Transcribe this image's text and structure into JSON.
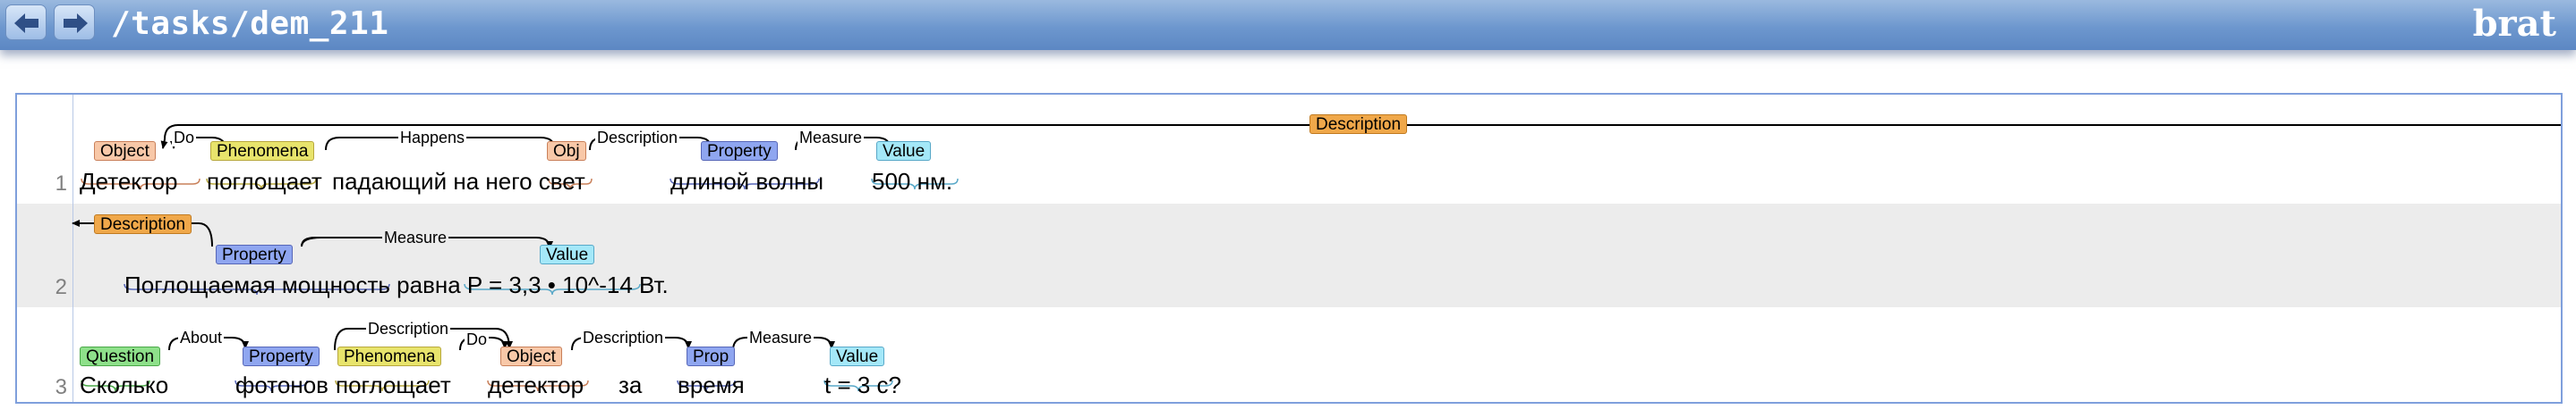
{
  "header": {
    "path": "/tasks/dem_211",
    "logo": "brat",
    "back_icon": "arrow-left-icon",
    "forward_icon": "arrow-right-icon"
  },
  "colors": {
    "Object": "#f8c8a8",
    "Phenomena": "#e8e46c",
    "Property": "#8fa6f0",
    "Value": "#a4e8f8",
    "Question": "#8ee08a",
    "Description": "#f0a84a"
  },
  "sentences": [
    {
      "num": "1",
      "tokens": [
        "Детектор",
        "поглощает",
        "падающий на него свет",
        "длиной волны",
        "500 нм."
      ],
      "labels": [
        "Object",
        "Phenomena",
        "Obj",
        "Property",
        "Value",
        "Description"
      ],
      "arcs": [
        "Do",
        "Happens",
        "Description",
        "Measure"
      ]
    },
    {
      "num": "2",
      "tokens": [
        "Поглощаемая мощность равна P = 3,3 • 10^-14 Вт."
      ],
      "labels": [
        "Description",
        "Property",
        "Value"
      ],
      "arcs": [
        "Measure"
      ]
    },
    {
      "num": "3",
      "tokens": [
        "Сколько",
        "фотонов",
        "поглощает",
        "детектор",
        "за",
        "время",
        "t = 3 с?"
      ],
      "labels": [
        "Question",
        "Property",
        "Phenomena",
        "Object",
        "Prop",
        "Value"
      ],
      "arcs": [
        "About",
        "Description",
        "Do",
        "Description",
        "Measure"
      ]
    }
  ]
}
